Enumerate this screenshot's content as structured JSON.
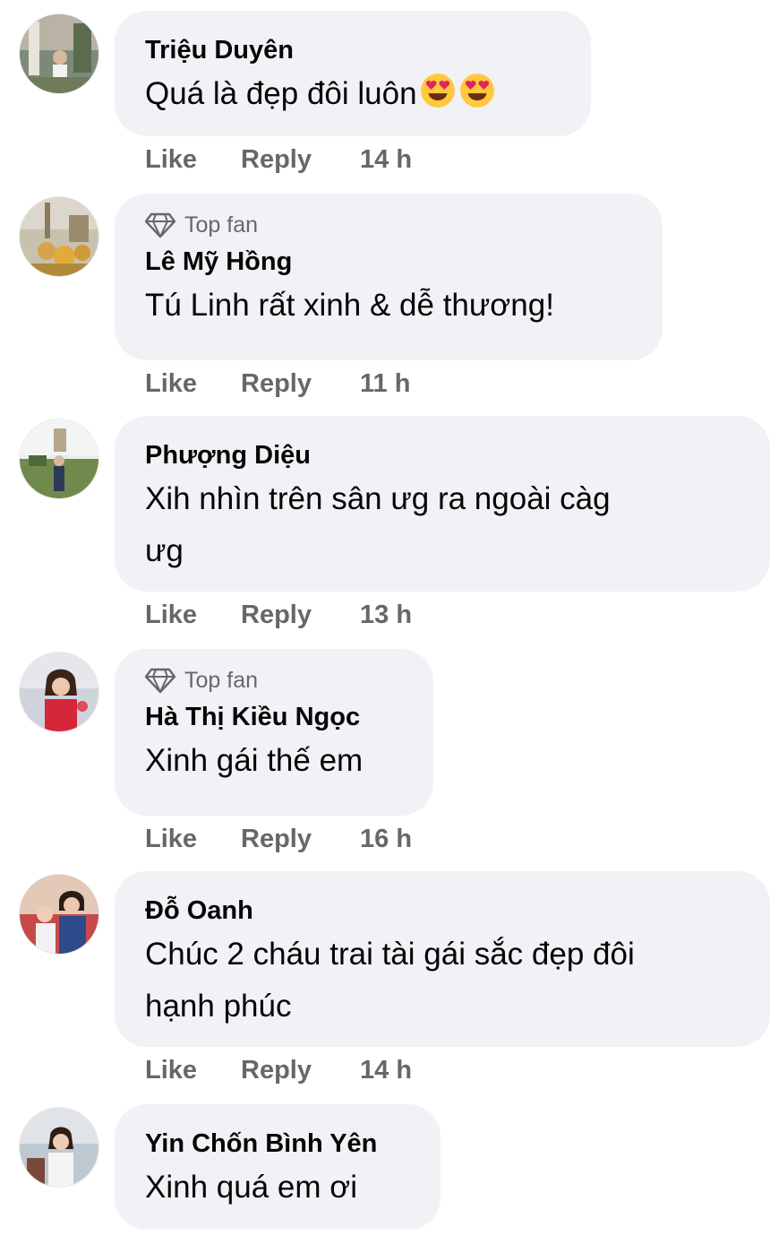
{
  "comments": [
    {
      "author": "Triệu Duyên",
      "top_fan": false,
      "text_lines": [
        "Quá là đẹp đôi luôn"
      ],
      "emojis": [
        "smiling-face-with-heart-eyes",
        "smiling-face-with-heart-eyes"
      ],
      "like_label": "Like",
      "reply_label": "Reply",
      "time": "14 h"
    },
    {
      "author": "Lê Mỹ Hồng",
      "top_fan": true,
      "top_fan_label": "Top fan",
      "text_lines": [
        "Tú Linh rất xinh & dễ thương!"
      ],
      "like_label": "Like",
      "reply_label": "Reply",
      "time": "11 h"
    },
    {
      "author": "Phượng Diệu",
      "top_fan": false,
      "text_lines": [
        "Xih nhìn trên sân ưg ra ngoài càg",
        "ưg"
      ],
      "like_label": "Like",
      "reply_label": "Reply",
      "time": "13 h"
    },
    {
      "author": "Hà Thị Kiều Ngọc",
      "top_fan": true,
      "top_fan_label": "Top fan",
      "text_lines": [
        "Xinh gái thế em"
      ],
      "like_label": "Like",
      "reply_label": "Reply",
      "time": "16 h"
    },
    {
      "author": "Đỗ Oanh",
      "top_fan": false,
      "text_lines": [
        "Chúc 2 cháu trai tài gái sắc đẹp đôi",
        "hạnh phúc"
      ],
      "like_label": "Like",
      "reply_label": "Reply",
      "time": "14 h"
    },
    {
      "author": "Yin Chốn Bình Yên",
      "top_fan": false,
      "text_lines": [
        "Xinh quá em ơi"
      ]
    }
  ],
  "colors": {
    "bubble_bg": "#f0f2f5",
    "secondary_text": "#65676b",
    "primary_text": "#050505"
  },
  "icons": {
    "top_fan_badge": "diamond-icon",
    "reaction_emoji": "heart-eyes-emoji-icon"
  }
}
